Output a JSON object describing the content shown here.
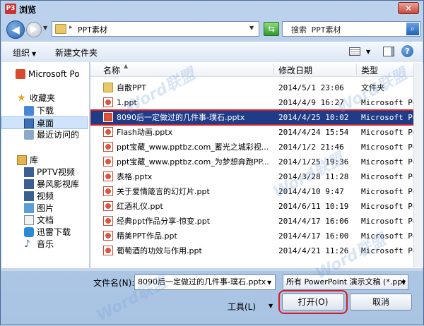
{
  "window": {
    "title": "浏览",
    "app_icon": "P3",
    "close_label": "✕"
  },
  "address": {
    "path": "PPT素材",
    "search_placeholder": "搜索 PPT素材"
  },
  "toolbar": {
    "organize": "组织",
    "new_folder": "新建文件夹"
  },
  "nav": [
    {
      "label": "Microsoft Po",
      "icon": "powerpoint-icon"
    },
    {
      "label": "收藏夹",
      "icon": "star-icon"
    },
    {
      "label": "下载",
      "icon": "download-icon"
    },
    {
      "label": "桌面",
      "icon": "desktop-icon",
      "selected": true
    },
    {
      "label": "最近访问的",
      "icon": "recent-icon"
    },
    {
      "label": "库",
      "icon": "library-icon"
    },
    {
      "label": "PPTV视频",
      "icon": "video-icon"
    },
    {
      "label": "暴风影视库",
      "icon": "video-icon"
    },
    {
      "label": "视频",
      "icon": "video-icon"
    },
    {
      "label": "图片",
      "icon": "picture-icon"
    },
    {
      "label": "文档",
      "icon": "document-icon"
    },
    {
      "label": "迅雷下载",
      "icon": "thunder-icon"
    },
    {
      "label": "音乐",
      "icon": "music-icon"
    }
  ],
  "columns": {
    "name": "名称",
    "date": "修改日期",
    "type": "类型"
  },
  "files": [
    {
      "name": "自散PPT",
      "date": "2014/5/1 23:06",
      "type": "文件夹",
      "kind": "folder"
    },
    {
      "name": "1.ppt",
      "date": "2014/4/9 16:27",
      "type": "Microsoft Pow",
      "kind": "ppt"
    },
    {
      "name": "8090后一定做过的几件事-璞石.pptx",
      "date": "2014/4/25 10:02",
      "type": "Microsoft Pow",
      "kind": "ppt",
      "selected": true
    },
    {
      "name": "Flash动画.pptx",
      "date": "2014/4/24 15:54",
      "type": "Microsoft Pow",
      "kind": "ppt"
    },
    {
      "name": "ppt宝藏_www.pptbz.com_蓄光之城彩视...",
      "date": "2014/1/2 21:46",
      "type": "Microsoft Pow",
      "kind": "ppt"
    },
    {
      "name": "ppt宝藏_www.pptbz.com_为梦想奔跑PP...",
      "date": "2014/1/25 19:36",
      "type": "Microsoft Pow",
      "kind": "ppt"
    },
    {
      "name": "表格.pptx",
      "date": "2014/3/28 11:28",
      "type": "Microsoft Pow",
      "kind": "ppt"
    },
    {
      "name": "关于爱情箴言的幻灯片.ppt",
      "date": "2014/4/10 9:47",
      "type": "Microsoft Pow",
      "kind": "ppt"
    },
    {
      "name": "红酒礼仪.ppt",
      "date": "2014/6/11 10:19",
      "type": "Microsoft Pow",
      "kind": "ppt"
    },
    {
      "name": "经典ppt作品分享-惊变.ppt",
      "date": "2014/4/17 16:06",
      "type": "Microsoft Pow",
      "kind": "ppt"
    },
    {
      "name": "精美PPT作品.ppt",
      "date": "2014/4/17 16:00",
      "type": "Microsoft Pow",
      "kind": "ppt"
    },
    {
      "name": "葡萄酒的功效与作用.ppt",
      "date": "2014/4/21 11:26",
      "type": "Microsoft Pow",
      "kind": "ppt"
    }
  ],
  "bottom": {
    "filename_label": "文件名(N):",
    "filename_value": "8090后一定做过的几件事-璞石.pptx",
    "filetype_value": "所有 PowerPoint 演示文稿 (*.ppt",
    "tools_label": "工具(L)",
    "open_label": "打开(O)",
    "cancel_label": "取消"
  },
  "watermark": "Word联盟"
}
